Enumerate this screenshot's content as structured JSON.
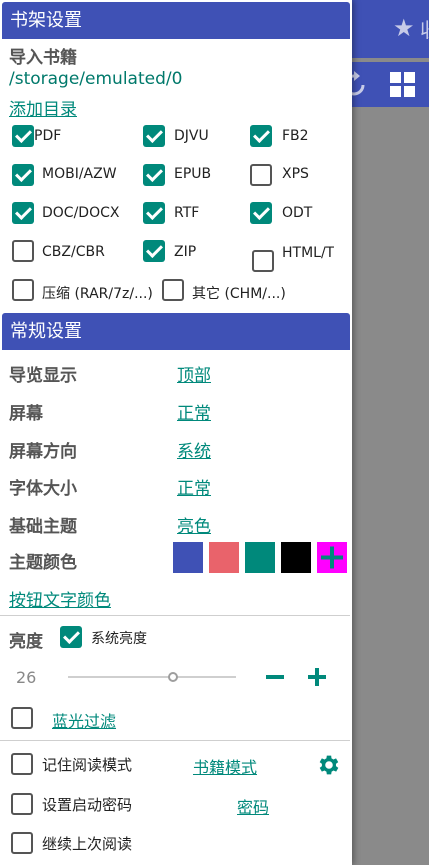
{
  "colors": {
    "header_bg": "#3f51b5",
    "accent": "#00897b",
    "swatches": [
      "#3f51b5",
      "#e9636b",
      "#00897b",
      "#000000",
      "#ff00ff"
    ]
  },
  "background_app": {
    "star_icon": "★",
    "tab_text": "收"
  },
  "bookshelf": {
    "header": "书架设置",
    "import_label": "导入书籍",
    "path": "/storage/emulated/0",
    "add_dir": "添加目录",
    "formats": [
      {
        "label": "PDF",
        "checked": true
      },
      {
        "label": "DJVU",
        "checked": true
      },
      {
        "label": "FB2",
        "checked": true
      },
      {
        "label": "MOBI/AZW",
        "checked": true
      },
      {
        "label": "EPUB",
        "checked": true
      },
      {
        "label": "XPS",
        "checked": false
      },
      {
        "label": "DOC/DOCX",
        "checked": true
      },
      {
        "label": "RTF",
        "checked": true
      },
      {
        "label": "ODT",
        "checked": true
      },
      {
        "label": "CBZ/CBR",
        "checked": false
      },
      {
        "label": "ZIP",
        "checked": true
      },
      {
        "label": "HTML/TXT",
        "checked": false
      },
      {
        "label": "压缩 (RAR/7z/...)",
        "checked": false
      },
      {
        "label": "其它 (CHM/...)",
        "checked": false
      }
    ]
  },
  "general": {
    "header": "常规设置",
    "rows": [
      {
        "label": "导览显示",
        "value": "顶部"
      },
      {
        "label": "屏幕",
        "value": "正常"
      },
      {
        "label": "屏幕方向",
        "value": "系统"
      },
      {
        "label": "字体大小",
        "value": "正常"
      },
      {
        "label": "基础主题",
        "value": "亮色"
      }
    ],
    "theme_color_label": "主题颜色",
    "button_text_color": "按钮文字颜色",
    "brightness_label": "亮度",
    "system_brightness": "系统亮度",
    "system_brightness_checked": true,
    "brightness_value": "26",
    "blue_filter": "蓝光过滤",
    "blue_filter_checked": false,
    "remember_mode": "记住阅读模式",
    "remember_mode_checked": false,
    "book_mode": "书籍模式",
    "startup_password": "设置启动密码",
    "startup_password_checked": false,
    "password": "密码",
    "continue_reading": "继续上次阅读",
    "continue_reading_checked": false
  }
}
